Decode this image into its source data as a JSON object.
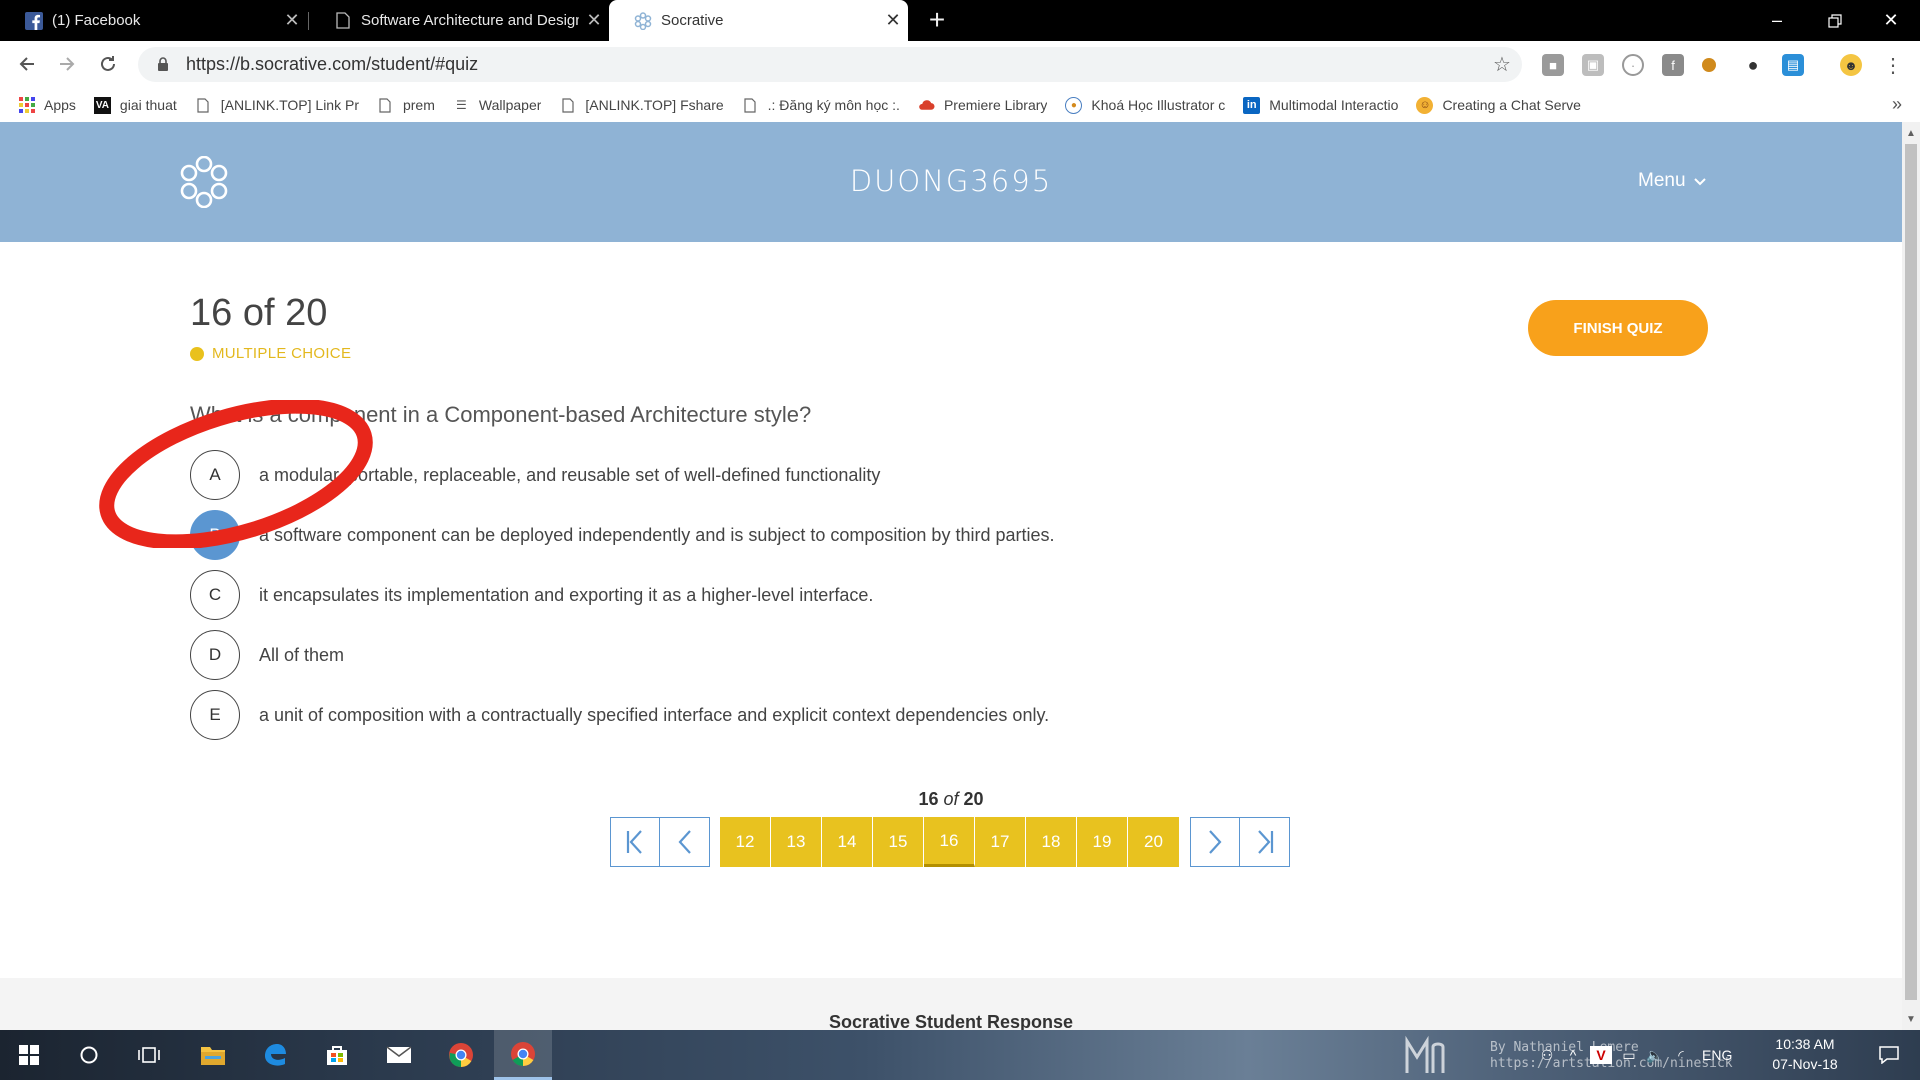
{
  "browser": {
    "tabs": [
      {
        "title": "(1) Facebook",
        "icon": "facebook-icon",
        "active": false
      },
      {
        "title": "Software Architecture and Design",
        "icon": "document-icon",
        "active": false
      },
      {
        "title": "Socrative",
        "icon": "socrative-icon",
        "active": true
      }
    ],
    "url": "https://b.socrative.com/student/#quiz",
    "bookmarks": [
      {
        "label": "Apps",
        "icon": "apps-grid-icon"
      },
      {
        "label": "giai thuat",
        "icon": "va-icon"
      },
      {
        "label": "[ANLINK.TOP] Link Pr",
        "icon": "document-icon"
      },
      {
        "label": "prem",
        "icon": "document-icon"
      },
      {
        "label": "Wallpaper",
        "icon": "wallpaper-icon"
      },
      {
        "label": "[ANLINK.TOP] Fshare",
        "icon": "document-icon"
      },
      {
        "label": ".: Đăng ký môn học :.",
        "icon": "document-icon"
      },
      {
        "label": "Premiere Library",
        "icon": "cloud-icon"
      },
      {
        "label": "Khoá Học Illustrator c",
        "icon": "globe-icon"
      },
      {
        "label": "Multimodal Interactio",
        "icon": "linkedin-icon"
      },
      {
        "label": "Creating a Chat Serve",
        "icon": "user-icon"
      }
    ]
  },
  "socrative": {
    "room_name": "DUONG3695",
    "menu_label": "Menu",
    "question_counter": "16 of 20",
    "question_type": "MULTIPLE CHOICE",
    "finish_label": "FINISH QUIZ",
    "question_text": "What is a component in a Component-based Architecture style?",
    "answers": [
      {
        "letter": "A",
        "text": "a modular, portable, replaceable, and reusable set of well-defined functionality",
        "selected": false
      },
      {
        "letter": "B",
        "text": "a software component can be deployed independently and is subject to composition by third parties.",
        "selected": true
      },
      {
        "letter": "C",
        "text": "it encapsulates its implementation and exporting it as a higher-level interface.",
        "selected": false
      },
      {
        "letter": "D",
        "text": "All of them",
        "selected": false
      },
      {
        "letter": "E",
        "text": "a unit of composition with a contractually specified interface and explicit context dependencies only.",
        "selected": false
      }
    ],
    "pager": {
      "current": "16",
      "of_word": "of",
      "total": "20",
      "pages": [
        "12",
        "13",
        "14",
        "15",
        "16",
        "17",
        "18",
        "19",
        "20"
      ]
    },
    "footer_title": "Socrative Student Response"
  },
  "taskbar": {
    "language": "ENG",
    "time": "10:38 AM",
    "date": "07-Nov-18",
    "watermark_line1": "By Nathaniel Lemere",
    "watermark_line2": "https://artstation.com/ninesick"
  },
  "colors": {
    "header_blue": "#8fb3d5",
    "accent_yellow": "#e8c21f",
    "finish_orange": "#f8a11b",
    "selected_blue": "#5b96d1",
    "annotation_red": "#e8261b"
  }
}
